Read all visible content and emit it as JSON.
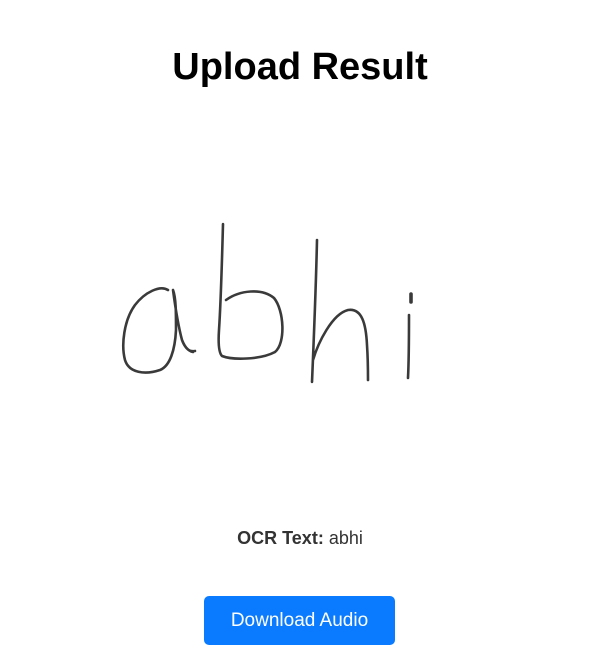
{
  "page": {
    "title": "Upload Result"
  },
  "image": {
    "handwritten_text": "abhi"
  },
  "ocr": {
    "label": "OCR Text:",
    "value": "abhi"
  },
  "actions": {
    "download_label": "Download Audio"
  },
  "colors": {
    "button_background": "#0a7bff",
    "button_text": "#ffffff",
    "title_text": "#000000",
    "ink": "#3a3a3a"
  },
  "icons": {
    "uploaded_image": "handwriting-image"
  }
}
